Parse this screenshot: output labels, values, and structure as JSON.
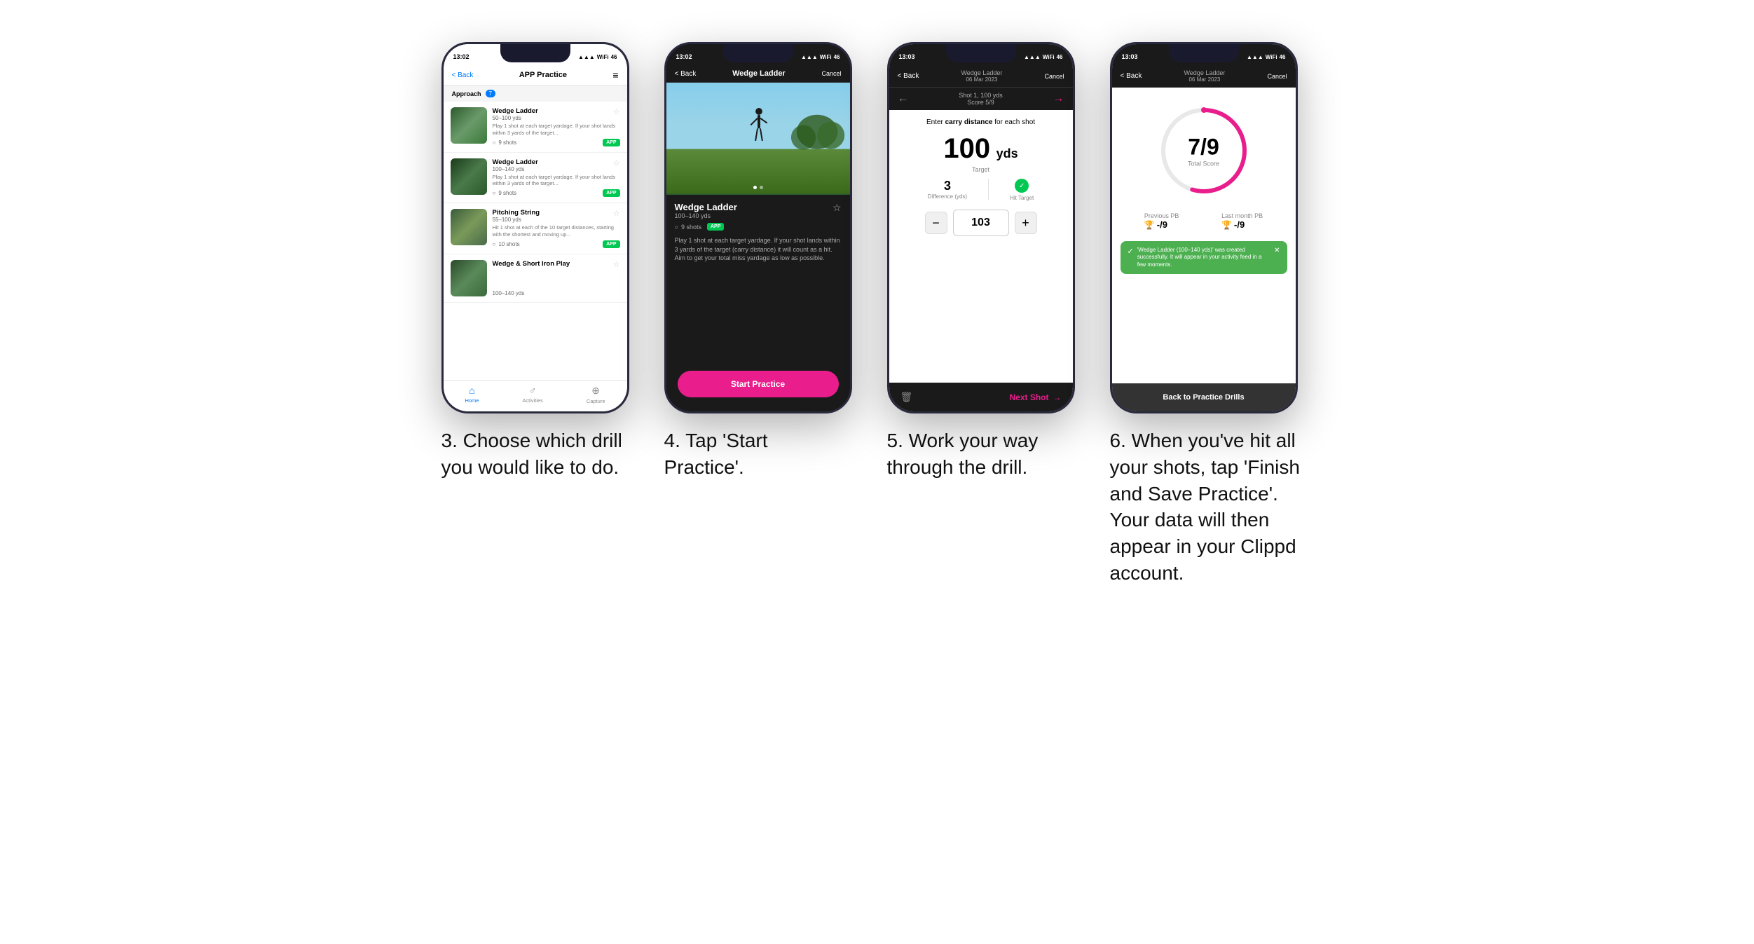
{
  "phones": [
    {
      "id": "phone1",
      "statusBar": {
        "time": "13:02",
        "signal": "●●●",
        "wifi": "wifi",
        "battery": "46"
      },
      "nav": {
        "back": "< Back",
        "title": "APP Practice",
        "action": "≡"
      },
      "section": {
        "label": "Approach",
        "count": "7"
      },
      "drills": [
        {
          "name": "Wedge Ladder",
          "yds": "50–100 yds",
          "desc": "Play 1 shot at each target yardage. If your shot lands within 3 yards of the target...",
          "shots": "9 shots",
          "badge": "APP"
        },
        {
          "name": "Wedge Ladder",
          "yds": "100–140 yds",
          "desc": "Play 1 shot at each target yardage. If your shot lands within 3 yards of the target...",
          "shots": "9 shots",
          "badge": "APP"
        },
        {
          "name": "Pitching String",
          "yds": "55–100 yds",
          "desc": "Hit 1 shot at each of the 10 target distances, starting with the shortest and moving up...",
          "shots": "10 shots",
          "badge": "APP"
        },
        {
          "name": "Wedge & Short Iron Play",
          "yds": "100–140 yds",
          "desc": "",
          "shots": "",
          "badge": ""
        }
      ],
      "bottomNav": [
        {
          "label": "Home",
          "icon": "⌂",
          "active": true
        },
        {
          "label": "Activities",
          "icon": "♂",
          "active": false
        },
        {
          "label": "Capture",
          "icon": "+",
          "active": false
        }
      ]
    },
    {
      "id": "phone2",
      "statusBar": {
        "time": "13:02",
        "signal": "●●●",
        "wifi": "wifi",
        "battery": "46"
      },
      "nav": {
        "back": "< Back",
        "title": "Wedge Ladder",
        "action": "Cancel"
      },
      "drillName": "Wedge Ladder",
      "drillYds": "100–140 yds",
      "shots": "9 shots",
      "badge": "APP",
      "description": "Play 1 shot at each target yardage. If your shot lands within 3 yards of the target (carry distance) it will count as a hit. Aim to get your total miss yardage as low as possible.",
      "startBtn": "Start Practice"
    },
    {
      "id": "phone3",
      "statusBar": {
        "time": "13:03",
        "signal": "●●●",
        "wifi": "wifi",
        "battery": "46"
      },
      "navTop": {
        "back": "< Back",
        "titleLine1": "Wedge Ladder",
        "titleLine2": "06 Mar 2023",
        "action": "Cancel"
      },
      "shotLabel": "Shot 1, 100 yds",
      "shotScore": "Score 5/9",
      "enterCarryLabel": "Enter carry distance for each shot",
      "target": "100",
      "targetUnit": "yds",
      "targetLabel": "Target",
      "difference": "3",
      "differenceLabel": "Difference (yds)",
      "hitTarget": "Hit Target",
      "inputValue": "103",
      "nextShot": "Next Shot"
    },
    {
      "id": "phone4",
      "statusBar": {
        "time": "13:03",
        "signal": "●●●",
        "wifi": "wifi",
        "battery": "46"
      },
      "navTop": {
        "back": "< Back",
        "titleLine1": "Wedge Ladder",
        "titleLine2": "06 Mar 2023",
        "action": "Cancel"
      },
      "totalScore": "7/9",
      "totalScoreLabel": "Total Score",
      "previousPB": "-/9",
      "lastMonthPB": "-/9",
      "previousPBLabel": "Previous PB",
      "lastMonthPBLabel": "Last month PB",
      "successMsg": "'Wedge Ladder (100–140 yds)' was created successfully. It will appear in your activity feed in a few moments.",
      "backBtn": "Back to Practice Drills"
    }
  ],
  "captions": [
    "3. Choose which drill you would like to do.",
    "4. Tap 'Start Practice'.",
    "5. Work your way through the drill.",
    "6. When you've hit all your shots, tap 'Finish and Save Practice'. Your data will then appear in your Clippd account."
  ]
}
